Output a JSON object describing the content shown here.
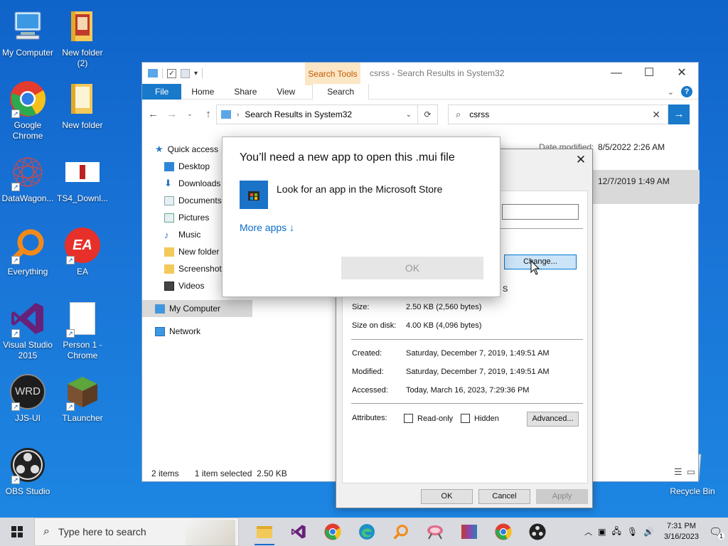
{
  "desktop_icons": [
    {
      "label": "My Computer"
    },
    {
      "label": "New folder\n(2)"
    },
    {
      "label": "Google\nChrome"
    },
    {
      "label": "New folder"
    },
    {
      "label": "DataWagon..."
    },
    {
      "label": "TS4_Downl..."
    },
    {
      "label": "Everything"
    },
    {
      "label": "EA"
    },
    {
      "label": "Visual Studio\n2015"
    },
    {
      "label": "Person 1 -\nChrome"
    },
    {
      "label": "JJS-UI"
    },
    {
      "label": "TLauncher"
    },
    {
      "label": "OBS Studio"
    },
    {
      "label": "Recycle Bin"
    }
  ],
  "explorer": {
    "context_tab": "Search Tools",
    "title": "csrss - Search Results in System32",
    "tabs": [
      "File",
      "Home",
      "Share",
      "View",
      "Search"
    ],
    "address": "Search Results in System32",
    "search_value": "csrss",
    "nav_pane": [
      {
        "label": "Quick access"
      },
      {
        "label": "Desktop"
      },
      {
        "label": "Downloads"
      },
      {
        "label": "Documents"
      },
      {
        "label": "Pictures"
      },
      {
        "label": "Music"
      },
      {
        "label": "New folder"
      },
      {
        "label": "Screenshots"
      },
      {
        "label": "Videos"
      },
      {
        "label": "My Computer"
      },
      {
        "label": "Network"
      }
    ],
    "column_header": "Date modified",
    "rows": [
      {
        "date": "8/5/2022 2:26 AM"
      },
      {
        "date": "12/7/2019 1:49 AM"
      }
    ],
    "status": {
      "items": "2 items",
      "selected": "1 item selected  2.50 KB"
    }
  },
  "properties": {
    "change_btn": "Change...",
    "partial_text": "S",
    "size_label": "Size:",
    "size_value": "2.50 KB (2,560 bytes)",
    "size_on_disk_label": "Size on disk:",
    "size_on_disk_value": "4.00 KB (4,096 bytes)",
    "created_label": "Created:",
    "created_value": "Saturday, December 7, 2019, 1:49:51 AM",
    "modified_label": "Modified:",
    "modified_value": "Saturday, December 7, 2019, 1:49:51 AM",
    "accessed_label": "Accessed:",
    "accessed_value": "Today, March 16, 2023, 7:29:36 PM",
    "attributes_label": "Attributes:",
    "readonly_label": "Read-only",
    "hidden_label": "Hidden",
    "advanced_btn": "Advanced...",
    "ok_btn": "OK",
    "cancel_btn": "Cancel",
    "apply_btn": "Apply"
  },
  "open_with": {
    "title": "You’ll need a new app to open this .mui file",
    "store_option": "Look for an app in the Microsoft Store",
    "more_apps": "More apps",
    "ok_btn": "OK"
  },
  "taskbar": {
    "search_placeholder": "Type here to search",
    "time": "7:31 PM",
    "date": "3/16/2023",
    "notification_count": "1"
  },
  "colors": {
    "accent": "#1979ca",
    "desktop": "#1973d6",
    "link": "#0a6cc8"
  }
}
